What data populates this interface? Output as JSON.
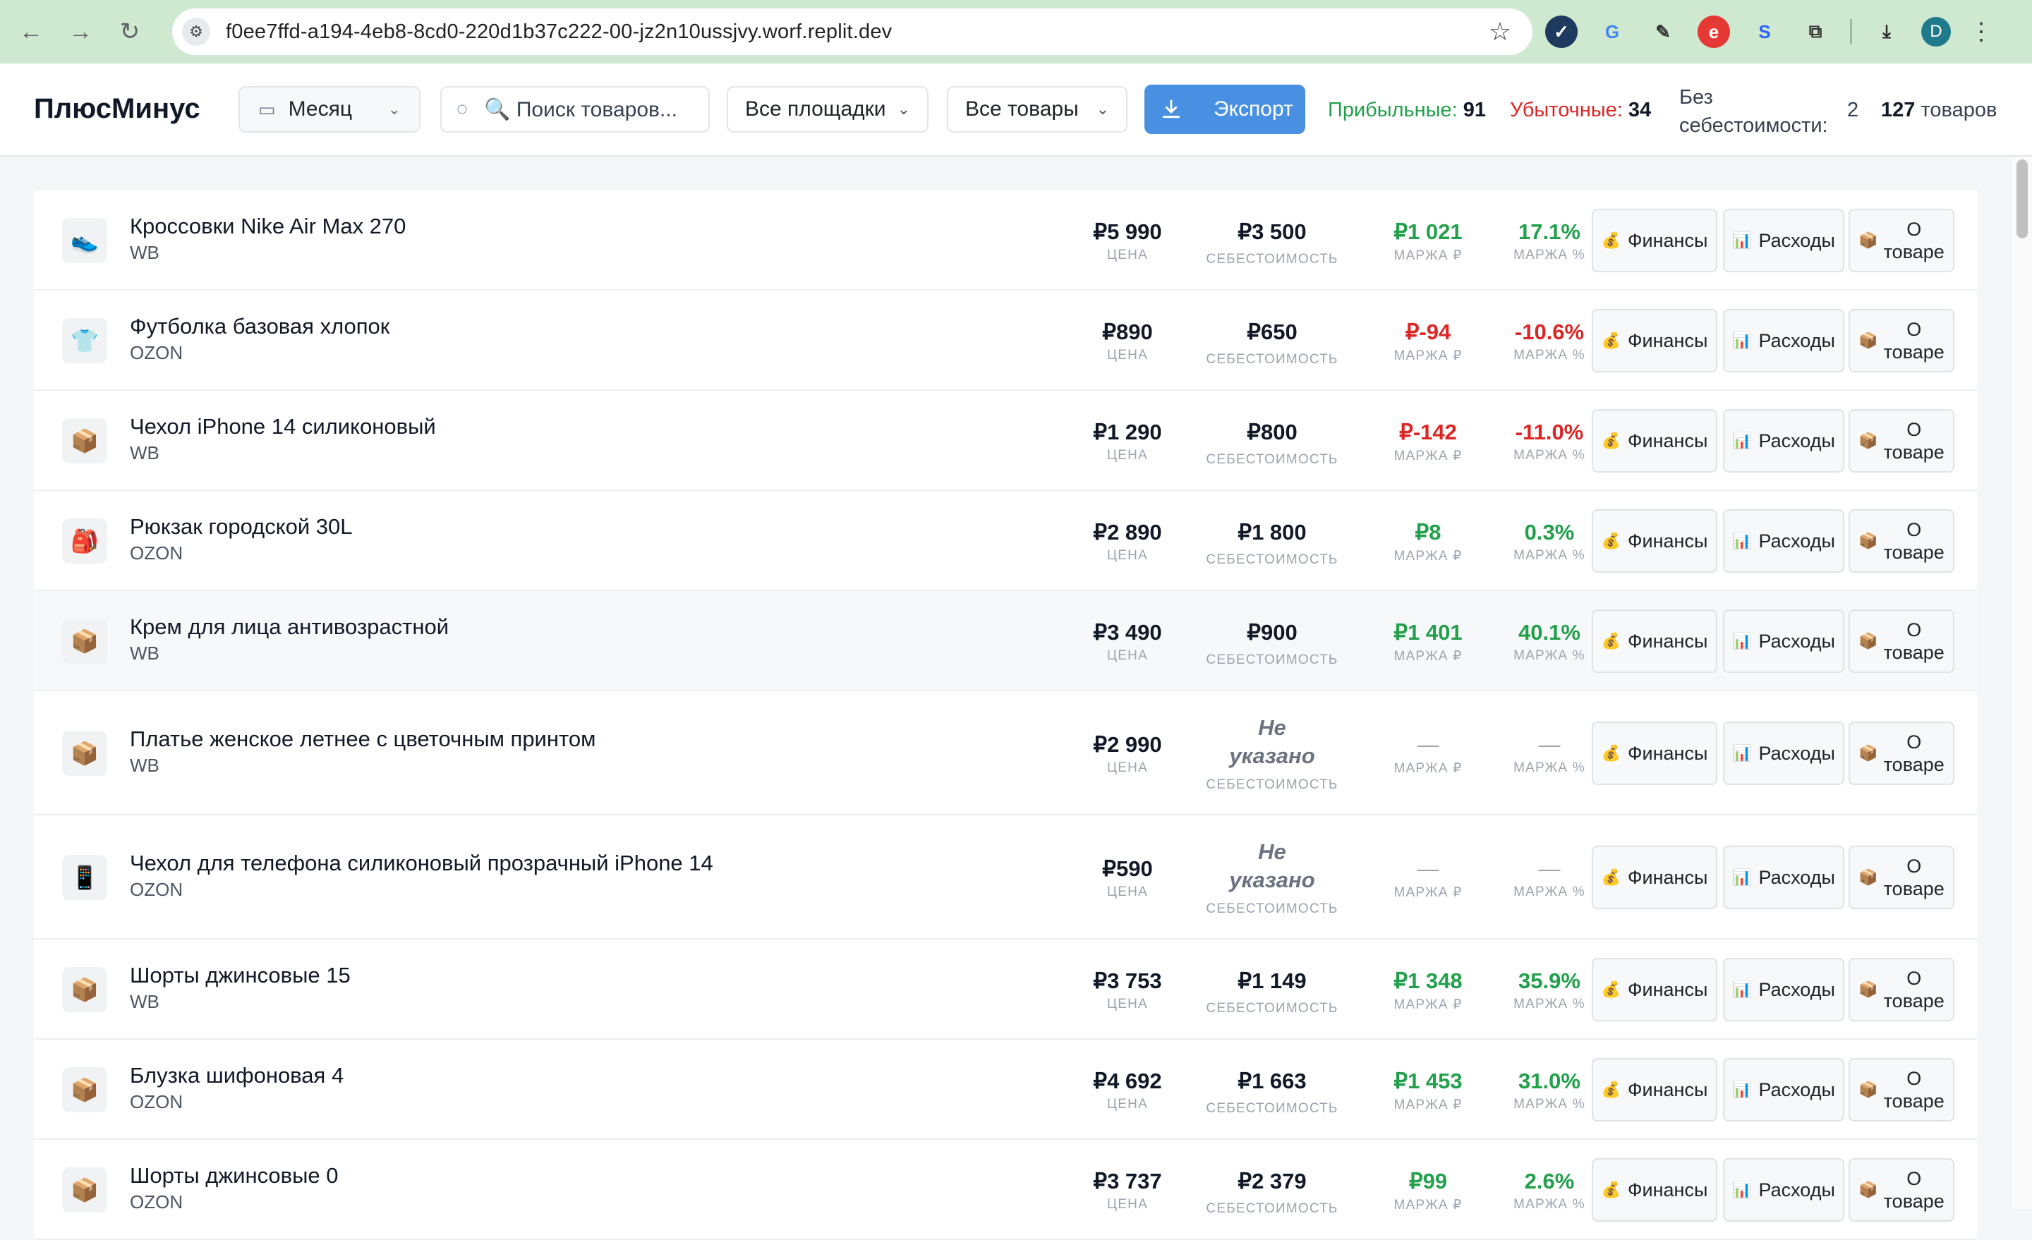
{
  "browser": {
    "url": "f0ee7ffd-a194-4eb8-8cd0-220d1b37c222-00-jz2n10ussjvy.worf.replit.dev",
    "avatar_letter": "D"
  },
  "header": {
    "logo": "ПлюсМинус",
    "period": "Месяц",
    "search_placeholder": "🔍 Поиск товаров...",
    "marketplace_filter": "Все площадки",
    "product_filter": "Все товары",
    "export_label": "Экспорт",
    "profitable_label": "Прибыльные:",
    "profitable_count": "91",
    "loss_label": "Убыточные:",
    "loss_count": "34",
    "no_cost_label_1": "Без",
    "no_cost_label_2": "себестоимости:",
    "no_cost_count": "2",
    "total_count": "127",
    "total_label": "товаров"
  },
  "labels": {
    "price": "ЦЕНА",
    "cost": "СЕБЕСТОИМОСТЬ",
    "margin_rub": "МАРЖА ₽",
    "margin_pct": "МАРЖА %",
    "finance": "Финансы",
    "expenses": "Расходы",
    "about_1": "О",
    "about_2": "товаре",
    "not_specified_1": "Не",
    "not_specified_2": "указано",
    "dash": "—"
  },
  "products": [
    {
      "icon": "👟",
      "name": "Кроссовки Nike Air Max 270",
      "market": "WB",
      "price": "₽5 990",
      "cost": "₽3 500",
      "margin": "₽1 021",
      "pct": "17.1%",
      "status": "pos"
    },
    {
      "icon": "👕",
      "name": "Футболка базовая хлопок",
      "market": "OZON",
      "price": "₽890",
      "cost": "₽650",
      "margin": "₽-94",
      "pct": "-10.6%",
      "status": "neg"
    },
    {
      "icon": "📦",
      "name": "Чехол iPhone 14 силиконовый",
      "market": "WB",
      "price": "₽1 290",
      "cost": "₽800",
      "margin": "₽-142",
      "pct": "-11.0%",
      "status": "neg"
    },
    {
      "icon": "🎒",
      "name": "Рюкзак городской 30L",
      "market": "OZON",
      "price": "₽2 890",
      "cost": "₽1 800",
      "margin": "₽8",
      "pct": "0.3%",
      "status": "pos"
    },
    {
      "icon": "📦",
      "name": "Крем для лица антивозрастной",
      "market": "WB",
      "price": "₽3 490",
      "cost": "₽900",
      "margin": "₽1 401",
      "pct": "40.1%",
      "status": "pos"
    },
    {
      "icon": "📦",
      "name": "Платье женское летнее с цветочным принтом",
      "market": "WB",
      "price": "₽2 990",
      "cost": null,
      "margin": "—",
      "pct": "—",
      "status": "none"
    },
    {
      "icon": "📱",
      "name": "Чехол для телефона силиконовый прозрачный iPhone 14",
      "market": "OZON",
      "price": "₽590",
      "cost": null,
      "margin": "—",
      "pct": "—",
      "status": "none"
    },
    {
      "icon": "📦",
      "name": "Шорты джинсовые 15",
      "market": "WB",
      "price": "₽3 753",
      "cost": "₽1 149",
      "margin": "₽1 348",
      "pct": "35.9%",
      "status": "pos"
    },
    {
      "icon": "📦",
      "name": "Блузка шифоновая 4",
      "market": "OZON",
      "price": "₽4 692",
      "cost": "₽1 663",
      "margin": "₽1 453",
      "pct": "31.0%",
      "status": "pos"
    },
    {
      "icon": "📦",
      "name": "Шорты джинсовые 0",
      "market": "OZON",
      "price": "₽3 737",
      "cost": "₽2 379",
      "margin": "₽99",
      "pct": "2.6%",
      "status": "pos"
    }
  ],
  "colors": {
    "positive": "#22a04b",
    "negative": "#dc2626",
    "accent": "#4a90e2",
    "browser_bar": "#cfe8d0"
  },
  "icons": [
    "back-icon",
    "forward-icon",
    "reload-icon",
    "site-settings-icon",
    "star-icon",
    "extensions-icon",
    "download-icon",
    "menu-icon",
    "calendar-icon",
    "search-icon",
    "chevron-down-icon",
    "download-icon"
  ]
}
